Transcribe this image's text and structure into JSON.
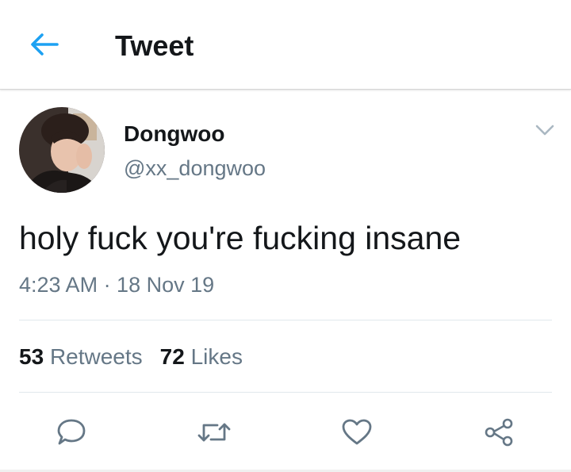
{
  "header": {
    "title": "Tweet",
    "back_icon": "arrow-left-icon",
    "accent": "#1da1f2"
  },
  "tweet": {
    "author": {
      "display_name": "Dongwoo",
      "handle": "@xx_dongwoo",
      "avatar_icon": "avatar-photo"
    },
    "menu_icon": "chevron-down-icon",
    "text": "holy fuck you're fucking insane",
    "timestamp": "4:23 AM · 18 Nov 19",
    "stats": {
      "retweets": {
        "count": "53",
        "label": "Retweets"
      },
      "likes": {
        "count": "72",
        "label": "Likes"
      }
    },
    "actions": [
      {
        "name": "reply",
        "icon": "speech-bubble-icon"
      },
      {
        "name": "retweet",
        "icon": "retweet-arrows-icon"
      },
      {
        "name": "like",
        "icon": "heart-icon"
      },
      {
        "name": "share",
        "icon": "share-nodes-icon"
      }
    ]
  },
  "colors": {
    "text": "#14171a",
    "secondary": "#657786",
    "divider": "#e1e8ed",
    "icon": "#657786"
  }
}
